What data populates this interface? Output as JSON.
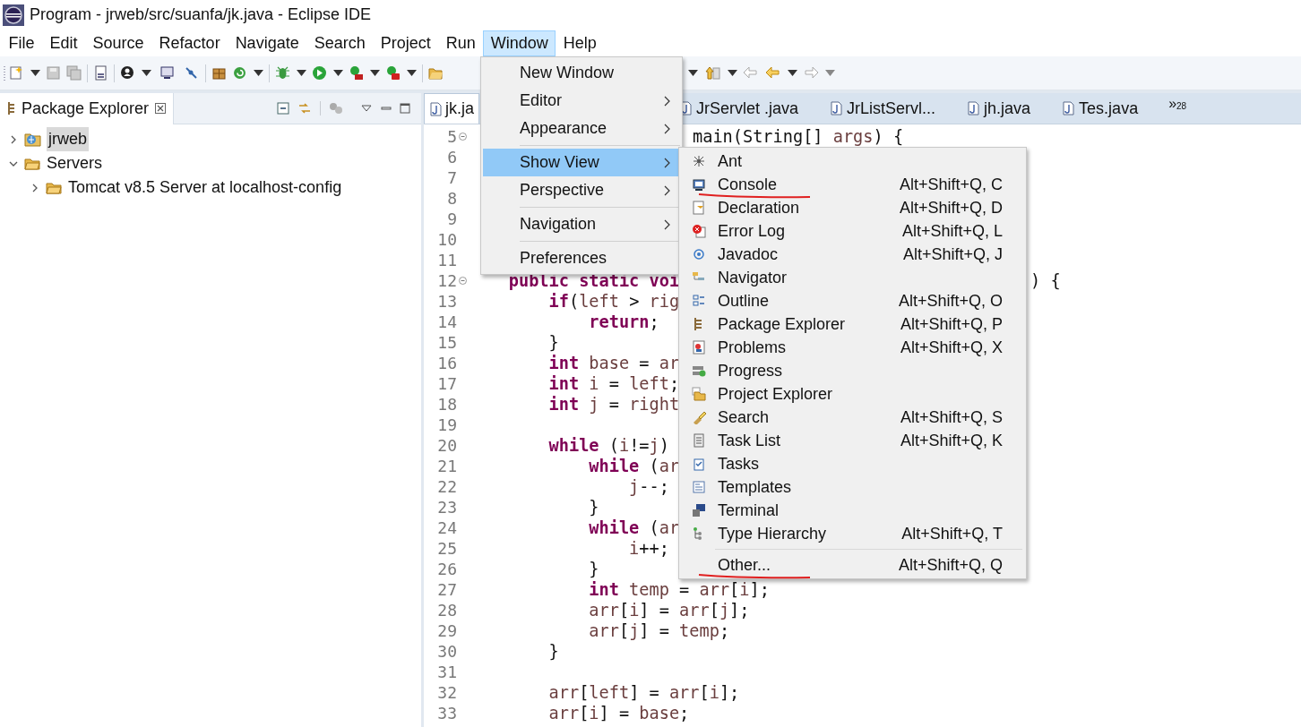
{
  "window": {
    "title": "Program - jrweb/src/suanfa/jk.java - Eclipse IDE"
  },
  "menu_bar": [
    {
      "label": "File",
      "selected": false
    },
    {
      "label": "Edit",
      "selected": false
    },
    {
      "label": "Source",
      "selected": false
    },
    {
      "label": "Refactor",
      "selected": false
    },
    {
      "label": "Navigate",
      "selected": false
    },
    {
      "label": "Search",
      "selected": false
    },
    {
      "label": "Project",
      "selected": false
    },
    {
      "label": "Run",
      "selected": false
    },
    {
      "label": "Window",
      "selected": true
    },
    {
      "label": "Help",
      "selected": false
    }
  ],
  "package_explorer": {
    "title": "Package Explorer",
    "tree": [
      {
        "label": "jrweb",
        "kind": "project",
        "expanded": false,
        "selected": true
      },
      {
        "label": "Servers",
        "kind": "folder",
        "expanded": true,
        "selected": false,
        "children": [
          {
            "label": "Tomcat v8.5 Server at localhost-config",
            "kind": "folder",
            "expanded": false,
            "selected": false
          }
        ]
      }
    ]
  },
  "editor": {
    "tabs": [
      {
        "label": "jk.ja",
        "selected": true
      },
      {
        "label": "JrServlet .java",
        "selected": false
      },
      {
        "label": "JrListServl...",
        "selected": false
      },
      {
        "label": "jh.java",
        "selected": false
      },
      {
        "label": "Tes.java",
        "selected": false
      }
    ],
    "overflow": {
      "glyph": "»",
      "count": "28"
    },
    "lines": [
      {
        "number": "5",
        "fold": true,
        "tail": [
          {
            "kind": "plain",
            "text": "main(String[] "
          },
          {
            "kind": "variable",
            "text": "args"
          },
          {
            "kind": "plain",
            "text": ") {"
          }
        ]
      },
      {
        "number": "6",
        "fold": false
      },
      {
        "number": "7",
        "fold": false
      },
      {
        "number": "8",
        "fold": false
      },
      {
        "number": "9",
        "fold": false
      },
      {
        "number": "10",
        "fold": false
      },
      {
        "number": "11",
        "fold": false
      },
      {
        "number": "12",
        "fold": true,
        "tokens": [
          {
            "kind": "keyword",
            "text": "    public"
          },
          {
            "kind": "keyword",
            "text": " static"
          },
          {
            "kind": "keyword",
            "text": " voi"
          }
        ],
        "tail": [
          {
            "kind": "plain",
            "text": ") {"
          }
        ]
      },
      {
        "number": "13",
        "fold": false,
        "tokens": [
          {
            "kind": "keyword",
            "text": "        if"
          },
          {
            "kind": "plain",
            "text": "("
          },
          {
            "kind": "variable",
            "text": "left"
          },
          {
            "kind": "plain",
            "text": " > "
          },
          {
            "kind": "variable",
            "text": "rig"
          }
        ]
      },
      {
        "number": "14",
        "fold": false,
        "tokens": [
          {
            "kind": "keyword",
            "text": "            return"
          },
          {
            "kind": "plain",
            "text": ";"
          }
        ]
      },
      {
        "number": "15",
        "fold": false,
        "tokens": [
          {
            "kind": "plain",
            "text": "        }"
          }
        ]
      },
      {
        "number": "16",
        "fold": false,
        "tokens": [
          {
            "kind": "keyword",
            "text": "        int"
          },
          {
            "kind": "variable",
            "text": " base"
          },
          {
            "kind": "plain",
            "text": " = "
          },
          {
            "kind": "variable",
            "text": "ar"
          }
        ]
      },
      {
        "number": "17",
        "fold": false,
        "tokens": [
          {
            "kind": "keyword",
            "text": "        int"
          },
          {
            "kind": "variable",
            "text": " i"
          },
          {
            "kind": "plain",
            "text": " = "
          },
          {
            "kind": "variable",
            "text": "left"
          },
          {
            "kind": "plain",
            "text": ";"
          }
        ]
      },
      {
        "number": "18",
        "fold": false,
        "tokens": [
          {
            "kind": "keyword",
            "text": "        int"
          },
          {
            "kind": "variable",
            "text": " j"
          },
          {
            "kind": "plain",
            "text": " = "
          },
          {
            "kind": "variable",
            "text": "right"
          }
        ]
      },
      {
        "number": "19",
        "fold": false
      },
      {
        "number": "20",
        "fold": false,
        "tokens": [
          {
            "kind": "keyword",
            "text": "        while"
          },
          {
            "kind": "plain",
            "text": " ("
          },
          {
            "kind": "variable",
            "text": "i"
          },
          {
            "kind": "plain",
            "text": "!="
          },
          {
            "kind": "variable",
            "text": "j"
          },
          {
            "kind": "plain",
            "text": ")"
          }
        ]
      },
      {
        "number": "21",
        "fold": false,
        "tokens": [
          {
            "kind": "keyword",
            "text": "            while"
          },
          {
            "kind": "plain",
            "text": " ("
          },
          {
            "kind": "variable",
            "text": "ar"
          }
        ]
      },
      {
        "number": "22",
        "fold": false,
        "tokens": [
          {
            "kind": "variable",
            "text": "                j"
          },
          {
            "kind": "plain",
            "text": "--;"
          }
        ]
      },
      {
        "number": "23",
        "fold": false,
        "tokens": [
          {
            "kind": "plain",
            "text": "            }"
          }
        ]
      },
      {
        "number": "24",
        "fold": false,
        "tokens": [
          {
            "kind": "keyword",
            "text": "            while"
          },
          {
            "kind": "plain",
            "text": " ("
          },
          {
            "kind": "variable",
            "text": "ar"
          }
        ]
      },
      {
        "number": "25",
        "fold": false,
        "tokens": [
          {
            "kind": "variable",
            "text": "                i"
          },
          {
            "kind": "plain",
            "text": "++;"
          }
        ]
      },
      {
        "number": "26",
        "fold": false,
        "tokens": [
          {
            "kind": "plain",
            "text": "            }"
          }
        ]
      },
      {
        "number": "27",
        "fold": false,
        "tokens": [
          {
            "kind": "keyword",
            "text": "            int"
          },
          {
            "kind": "variable",
            "text": " temp"
          },
          {
            "kind": "plain",
            "text": " = "
          },
          {
            "kind": "variable",
            "text": "arr"
          },
          {
            "kind": "plain",
            "text": "["
          },
          {
            "kind": "variable",
            "text": "i"
          },
          {
            "kind": "plain",
            "text": "];"
          }
        ]
      },
      {
        "number": "28",
        "fold": false,
        "tokens": [
          {
            "kind": "variable",
            "text": "            arr"
          },
          {
            "kind": "plain",
            "text": "["
          },
          {
            "kind": "variable",
            "text": "i"
          },
          {
            "kind": "plain",
            "text": "] = "
          },
          {
            "kind": "variable",
            "text": "arr"
          },
          {
            "kind": "plain",
            "text": "["
          },
          {
            "kind": "variable",
            "text": "j"
          },
          {
            "kind": "plain",
            "text": "];"
          }
        ]
      },
      {
        "number": "29",
        "fold": false,
        "tokens": [
          {
            "kind": "variable",
            "text": "            arr"
          },
          {
            "kind": "plain",
            "text": "["
          },
          {
            "kind": "variable",
            "text": "j"
          },
          {
            "kind": "plain",
            "text": "] = "
          },
          {
            "kind": "variable",
            "text": "temp"
          },
          {
            "kind": "plain",
            "text": ";"
          }
        ]
      },
      {
        "number": "30",
        "fold": false,
        "tokens": [
          {
            "kind": "plain",
            "text": "        }"
          }
        ]
      },
      {
        "number": "31",
        "fold": false
      },
      {
        "number": "32",
        "fold": false,
        "tokens": [
          {
            "kind": "variable",
            "text": "        arr"
          },
          {
            "kind": "plain",
            "text": "["
          },
          {
            "kind": "variable",
            "text": "left"
          },
          {
            "kind": "plain",
            "text": "] = "
          },
          {
            "kind": "variable",
            "text": "arr"
          },
          {
            "kind": "plain",
            "text": "["
          },
          {
            "kind": "variable",
            "text": "i"
          },
          {
            "kind": "plain",
            "text": "];"
          }
        ]
      },
      {
        "number": "33",
        "fold": false,
        "tokens": [
          {
            "kind": "variable",
            "text": "        arr"
          },
          {
            "kind": "plain",
            "text": "["
          },
          {
            "kind": "variable",
            "text": "i"
          },
          {
            "kind": "plain",
            "text": "] = "
          },
          {
            "kind": "variable",
            "text": "base"
          },
          {
            "kind": "plain",
            "text": ";"
          }
        ]
      }
    ]
  },
  "window_menu": {
    "items": [
      {
        "label": "New Window",
        "submenu": false,
        "separator_before": false,
        "selected": false
      },
      {
        "label": "Editor",
        "submenu": true,
        "separator_before": false,
        "selected": false
      },
      {
        "label": "Appearance",
        "submenu": true,
        "separator_before": false,
        "selected": false
      },
      {
        "label": "Show View",
        "submenu": true,
        "separator_before": true,
        "selected": true
      },
      {
        "label": "Perspective",
        "submenu": true,
        "separator_before": false,
        "selected": false
      },
      {
        "label": "Navigation",
        "submenu": true,
        "separator_before": true,
        "selected": false
      },
      {
        "label": "Preferences",
        "submenu": false,
        "separator_before": true,
        "selected": false
      }
    ]
  },
  "show_view_menu": {
    "items": [
      {
        "label": "Ant",
        "marked": false,
        "separator_before": false
      },
      {
        "label": "Console",
        "shortcut": "Alt+Shift+Q, C",
        "marked": true,
        "separator_before": false
      },
      {
        "label": "Declaration",
        "shortcut": "Alt+Shift+Q, D",
        "marked": false,
        "separator_before": false
      },
      {
        "label": "Error Log",
        "shortcut": "Alt+Shift+Q, L",
        "marked": false,
        "separator_before": false
      },
      {
        "label": "Javadoc",
        "shortcut": "Alt+Shift+Q, J",
        "marked": false,
        "separator_before": false
      },
      {
        "label": "Navigator",
        "marked": false,
        "separator_before": false
      },
      {
        "label": "Outline",
        "shortcut": "Alt+Shift+Q, O",
        "marked": false,
        "separator_before": false
      },
      {
        "label": "Package Explorer",
        "shortcut": "Alt+Shift+Q, P",
        "marked": false,
        "separator_before": false
      },
      {
        "label": "Problems",
        "shortcut": "Alt+Shift+Q, X",
        "marked": false,
        "separator_before": false
      },
      {
        "label": "Progress",
        "marked": false,
        "separator_before": false
      },
      {
        "label": "Project Explorer",
        "marked": false,
        "separator_before": false
      },
      {
        "label": "Search",
        "shortcut": "Alt+Shift+Q, S",
        "marked": false,
        "separator_before": false
      },
      {
        "label": "Task List",
        "shortcut": "Alt+Shift+Q, K",
        "marked": false,
        "separator_before": false
      },
      {
        "label": "Tasks",
        "marked": false,
        "separator_before": false
      },
      {
        "label": "Templates",
        "marked": false,
        "separator_before": false
      },
      {
        "label": "Terminal",
        "marked": false,
        "separator_before": false
      },
      {
        "label": "Type Hierarchy",
        "shortcut": "Alt+Shift+Q, T",
        "marked": false,
        "separator_before": false
      },
      {
        "label": "Other...",
        "shortcut": "Alt+Shift+Q, Q",
        "marked": true,
        "separator_before": true
      }
    ]
  }
}
